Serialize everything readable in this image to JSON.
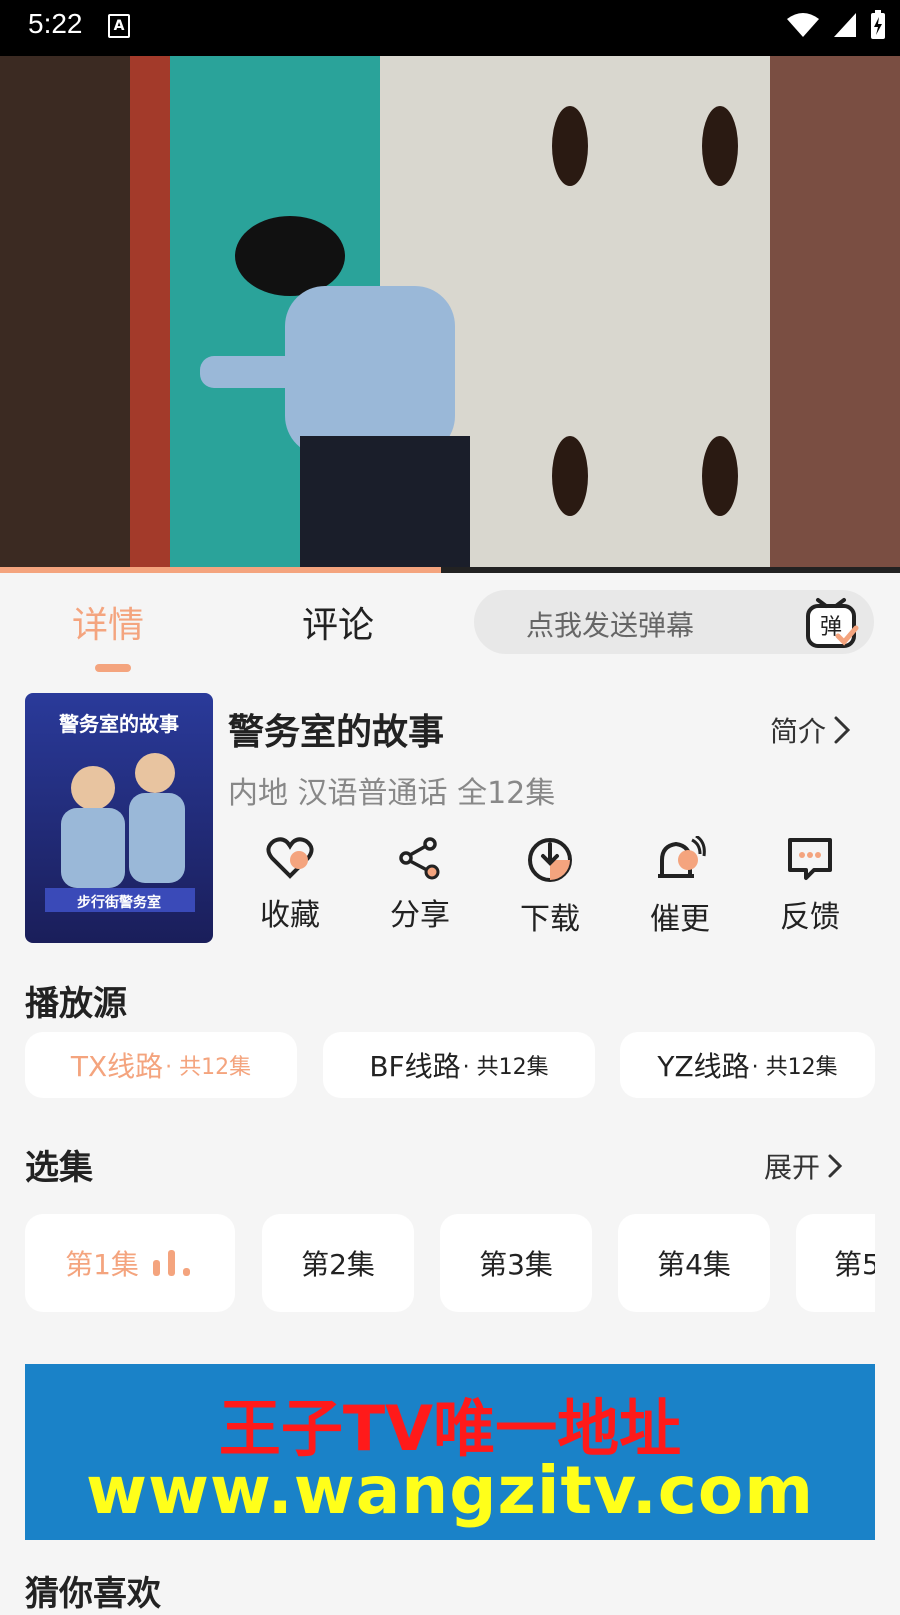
{
  "status_bar": {
    "time": "5:22",
    "a_badge": "A"
  },
  "video": {
    "progress_percent": 49
  },
  "tabs": {
    "detail": "详情",
    "comments": "评论"
  },
  "danmaku": {
    "placeholder": "点我发送弹幕",
    "icon_label": "弹"
  },
  "poster": {
    "title_text": "警务室的故事",
    "sub_text": "步行街警务室"
  },
  "show": {
    "title": "警务室的故事",
    "intro_label": "简介",
    "meta": "内地 汉语普通话 全12集"
  },
  "actions": [
    {
      "label": "收藏",
      "icon": "heart-icon"
    },
    {
      "label": "分享",
      "icon": "share-icon"
    },
    {
      "label": "下载",
      "icon": "download-icon"
    },
    {
      "label": "催更",
      "icon": "bell-icon"
    },
    {
      "label": "反馈",
      "icon": "feedback-icon"
    }
  ],
  "sources": {
    "title": "播放源",
    "items": [
      {
        "name": "TX线路",
        "count": " · 共12集"
      },
      {
        "name": "BF线路",
        "count": " · 共12集"
      },
      {
        "name": "YZ线路",
        "count": " · 共12集"
      }
    ]
  },
  "episodes": {
    "title": "选集",
    "expand_label": "展开",
    "items": [
      "第1集",
      "第2集",
      "第3集",
      "第4集",
      "第5"
    ]
  },
  "ad": {
    "line1": "王子TV唯一地址",
    "line2": "www.wangzitv.com"
  },
  "recommend": {
    "title": "猜你喜欢"
  },
  "colors": {
    "accent": "#f4a47e",
    "background": "#f5f5f5"
  }
}
